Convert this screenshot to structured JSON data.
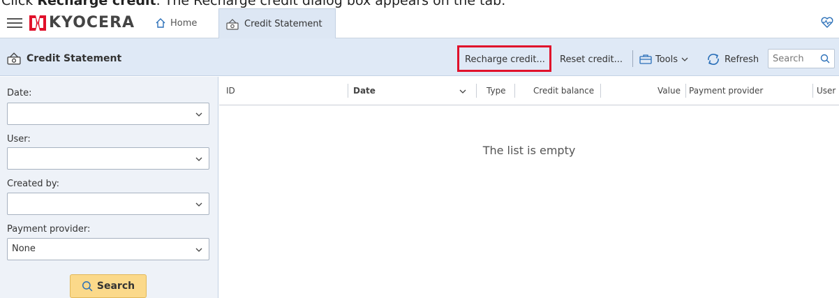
{
  "caption": {
    "prefix": "Click ",
    "bold": "Recharge credit",
    "suffix": ". The Recharge credit dialog box appears on the tab."
  },
  "app": {
    "logo_text": "KYOCERA",
    "logo_color": "#e0112b"
  },
  "tabs": {
    "home": "Home",
    "active": "Credit Statement"
  },
  "toolbar": {
    "title": "Credit Statement",
    "recharge": "Recharge credit...",
    "reset": "Reset credit...",
    "tools": "Tools",
    "refresh": "Refresh",
    "search_placeholder": "Search",
    "highlight_color": "#e0112b"
  },
  "filters": {
    "date_label": "Date:",
    "date_value": "",
    "user_label": "User:",
    "user_value": "",
    "created_by_label": "Created by:",
    "created_by_value": "",
    "provider_label": "Payment provider:",
    "provider_value": "None",
    "search_button": "Search"
  },
  "grid": {
    "columns": [
      "ID",
      "Date",
      "Type",
      "Credit balance",
      "Value",
      "Payment provider",
      "User"
    ],
    "sorted_column": "Date",
    "empty_text": "The list is empty"
  },
  "icons": [
    "hamburger-icon",
    "home-icon",
    "credit-statement-icon",
    "heart-pulse-icon",
    "toolbox-icon",
    "chevron-down-icon",
    "refresh-icon",
    "search-icon"
  ]
}
